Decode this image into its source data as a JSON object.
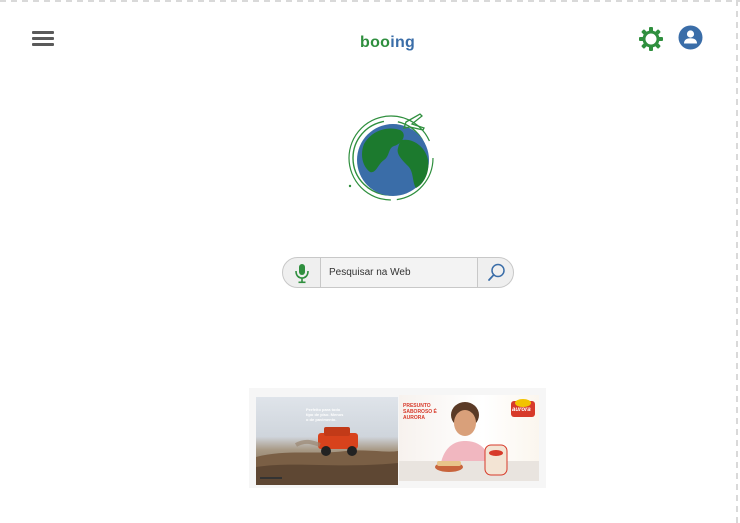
{
  "header": {
    "brand_part1": "boo",
    "brand_part2": "ing",
    "menu_icon": "hamburger-menu-icon",
    "settings_icon": "gear-icon",
    "user_icon": "user-avatar-icon"
  },
  "logo": {
    "icon": "globe-airplane-icon"
  },
  "search": {
    "placeholder": "Pesquisar na Web",
    "mic_icon": "microphone-icon",
    "search_icon": "magnifier-icon"
  },
  "ad": {
    "left_headline": "Perfeito para todo tipo de piso. Menos o de pavimento.",
    "right_headline": "PRESUNTO SABOROSO É AURORA",
    "brand": "aurora"
  },
  "colors": {
    "brand_green": "#2f8f3e",
    "brand_blue": "#3a6da8",
    "icon_gray": "#5a5a5a"
  }
}
